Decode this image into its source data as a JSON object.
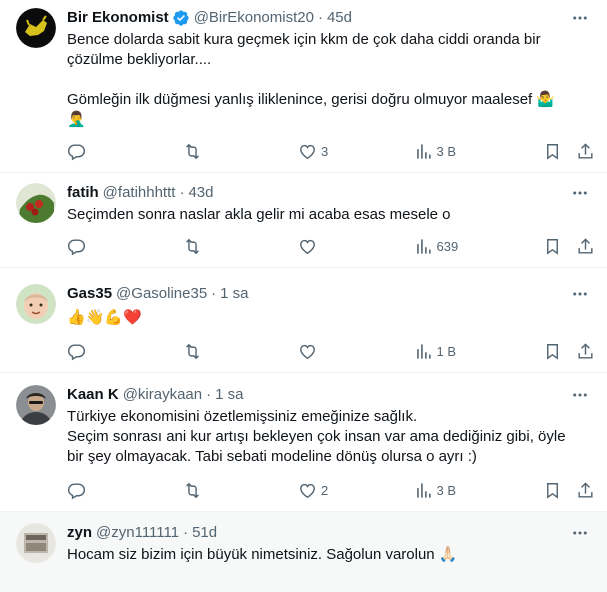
{
  "tweets": [
    {
      "name": "Bir Ekonomist",
      "verified": true,
      "handle": "@BirEkonomist20",
      "time": "45d",
      "text": "Bence dolarda sabit kura geçmek için kkm de çok daha ciddi oranda bir çözülme bekliyorlar....\n\nGömleğin ilk düğmesi yanlış iliklenince, gerisi doğru olmuyor maalesef 🤷‍♂️\n🤦‍♂️",
      "reply_count": "",
      "retweet_count": "",
      "like_count": "3",
      "view_count": "3 B"
    },
    {
      "name": "fatih",
      "verified": false,
      "handle": "@fatihhhttt",
      "time": "43d",
      "text": "Seçimden sonra naslar akla gelir mi acaba esas mesele o",
      "reply_count": "",
      "retweet_count": "",
      "like_count": "",
      "view_count": "639"
    },
    {
      "name": "Gas35",
      "verified": false,
      "handle": "@Gasoline35",
      "time": "1 sa",
      "text": "👍👋💪❤️",
      "reply_count": "",
      "retweet_count": "",
      "like_count": "",
      "view_count": "1 B"
    },
    {
      "name": "Kaan K",
      "verified": false,
      "handle": "@kiraykaan",
      "time": "1 sa",
      "text": "Türkiye ekonomisini özetlemişsiniz emeğinize sağlık.\nSeçim sonrası ani kur artışı bekleyen çok insan var ama dediğiniz gibi, öyle bir şey olmayacak. Tabi sebati modeline dönüş olursa o ayrı :)",
      "reply_count": "",
      "retweet_count": "",
      "like_count": "2",
      "view_count": "3 B"
    },
    {
      "name": "zyn",
      "verified": false,
      "handle": "@zyn111111",
      "time": "51d",
      "text": "Hocam siz bizim için büyük nimetsiniz. Sağolun varolun 🙏🏻",
      "reply_count": "",
      "retweet_count": "",
      "like_count": "",
      "view_count": ""
    }
  ],
  "colors": {
    "text": "#0f1419",
    "secondary": "#536471",
    "verified": "#1d9bf0",
    "divider": "#eff3f4"
  },
  "separator_dot": "·"
}
